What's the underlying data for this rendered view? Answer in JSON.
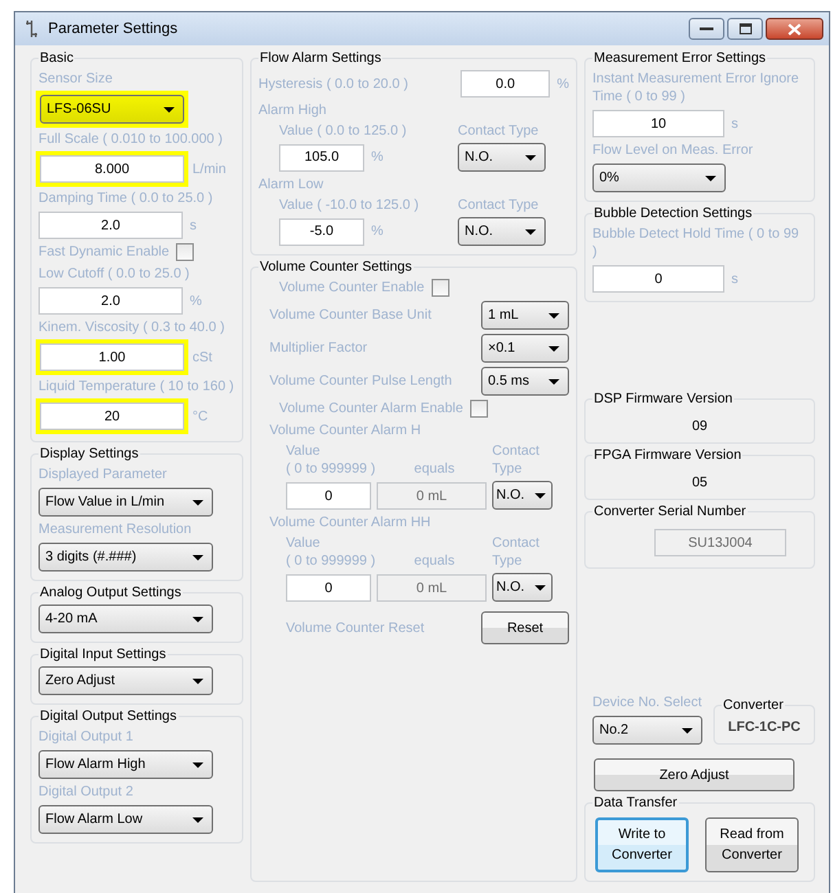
{
  "window": {
    "title": "Parameter Settings"
  },
  "columns": [
    {
      "items": [
        {
          "kind": "group",
          "title": "Basic",
          "items": [
            {
              "kind": "label",
              "text": "Sensor Size"
            },
            {
              "kind": "select",
              "value": "LFS-06SU",
              "highlighted": true
            },
            {
              "kind": "label",
              "text": "Full Scale ( 0.010 to 100.000 )"
            },
            {
              "kind": "field",
              "value": "8.000",
              "unit": "L/min",
              "highlighted": true
            },
            {
              "kind": "label",
              "text": "Damping Time ( 0.0 to 25.0 )"
            },
            {
              "kind": "field",
              "value": "2.0",
              "unit": "s",
              "highlighted": false
            },
            {
              "kind": "checkbox",
              "label": "Fast Dynamic Enable",
              "checked": false
            },
            {
              "kind": "label",
              "text": "Low Cutoff ( 0.0 to 25.0 )"
            },
            {
              "kind": "field",
              "value": "2.0",
              "unit": "%",
              "highlighted": false
            },
            {
              "kind": "label",
              "text": "Kinem. Viscosity ( 0.3 to 40.0 )"
            },
            {
              "kind": "field",
              "value": "1.00",
              "unit": "cSt",
              "highlighted": true
            },
            {
              "kind": "label",
              "text": "Liquid Temperature ( 10 to 160 )"
            },
            {
              "kind": "field",
              "value": "20",
              "unit": "°C",
              "highlighted": true
            }
          ]
        },
        {
          "kind": "group",
          "title": "Display Settings",
          "items": [
            {
              "kind": "label",
              "text": "Displayed Parameter"
            },
            {
              "kind": "select",
              "value": "Flow Value in L/min",
              "highlighted": false
            },
            {
              "kind": "label",
              "text": "Measurement Resolution"
            },
            {
              "kind": "select",
              "value": "3 digits (#.###)",
              "highlighted": false
            }
          ]
        },
        {
          "kind": "group",
          "title": "Analog Output Settings",
          "items": [
            {
              "kind": "select",
              "value": "4-20 mA",
              "highlighted": false
            }
          ]
        },
        {
          "kind": "group",
          "title": "Digital Input Settings",
          "items": [
            {
              "kind": "select",
              "value": "Zero Adjust",
              "highlighted": false
            }
          ]
        },
        {
          "kind": "group",
          "title": "Digital Output Settings",
          "items": [
            {
              "kind": "label",
              "text": "Digital Output 1"
            },
            {
              "kind": "select",
              "value": "Flow Alarm High",
              "highlighted": false
            },
            {
              "kind": "label",
              "text": "Digital Output 2"
            },
            {
              "kind": "select",
              "value": "Flow Alarm Low",
              "highlighted": false
            }
          ]
        }
      ]
    },
    {
      "items": [
        {
          "kind": "group",
          "title": "Flow Alarm Settings",
          "items": [
            {
              "kind": "labeled_field",
              "label": "Hysteresis ( 0.0 to 20.0 )",
              "value": "0.0",
              "unit": "%"
            },
            {
              "kind": "alarm",
              "title": "Alarm High",
              "value_label": "Value ( 0.0 to 125.0 )",
              "value": "105.0",
              "unit": "%",
              "contact_label": "Contact Type",
              "contact": "N.O."
            },
            {
              "kind": "alarm",
              "title": "Alarm Low",
              "value_label": "Value ( -10.0 to 125.0 )",
              "value": "-5.0",
              "unit": "%",
              "contact_label": "Contact Type",
              "contact": "N.O."
            }
          ]
        },
        {
          "kind": "group",
          "title": "Volume Counter Settings",
          "items": [
            {
              "kind": "checkbox",
              "label": "Volume Counter Enable",
              "checked": false
            },
            {
              "kind": "labeled_select",
              "label": "Volume Counter Base Unit",
              "value": "1 mL"
            },
            {
              "kind": "labeled_select",
              "label": "Multiplier Factor",
              "value": "×0.1"
            },
            {
              "kind": "labeled_select",
              "label": "Volume Counter Pulse Length",
              "value": "0.5 ms"
            },
            {
              "kind": "checkbox",
              "label": "Volume Counter Alarm Enable",
              "checked": false
            },
            {
              "kind": "counter_alarm",
              "title": "Volume Counter Alarm H",
              "value_label": "Value\n( 0 to 999999 )",
              "equals_label": "equals",
              "value": "0",
              "equals_value": "0 mL",
              "contact_label": "Contact Type",
              "contact": "N.O."
            },
            {
              "kind": "counter_alarm",
              "title": "Volume Counter Alarm HH",
              "value_label": "Value\n( 0 to 999999 )",
              "equals_label": "equals",
              "value": "0",
              "equals_value": "0 mL",
              "contact_label": "Contact Type",
              "contact": "N.O."
            },
            {
              "kind": "labeled_button",
              "label": "Volume Counter Reset",
              "button": "Reset"
            }
          ]
        }
      ]
    },
    {
      "items": [
        {
          "kind": "group",
          "title": "Measurement Error Settings",
          "items": [
            {
              "kind": "label",
              "text": "Instant Measurement Error Ignore Time ( 0 to 99 )"
            },
            {
              "kind": "field",
              "value": "10",
              "unit": "s",
              "highlighted": false
            },
            {
              "kind": "label",
              "text": "Flow Level on Meas. Error"
            },
            {
              "kind": "select",
              "value": "0%",
              "highlighted": false
            }
          ]
        },
        {
          "kind": "group",
          "title": "Bubble Detection Settings",
          "items": [
            {
              "kind": "label",
              "text": "Bubble Detect Hold Time ( 0 to 99 )"
            },
            {
              "kind": "field",
              "value": "0",
              "unit": "s",
              "highlighted": false
            }
          ]
        },
        {
          "kind": "readout",
          "title": "DSP Firmware Version",
          "value": "09"
        },
        {
          "kind": "readout",
          "title": "FPGA Firmware Version",
          "value": "05"
        },
        {
          "kind": "readonly",
          "title": "Converter Serial Number",
          "value": "SU13J004"
        },
        {
          "kind": "device_row",
          "label": "Device No. Select",
          "value": "No.2",
          "converter_title": "Converter",
          "converter_model": "LFC-1C-PC"
        },
        {
          "kind": "button",
          "label": "Zero Adjust"
        },
        {
          "kind": "transfer",
          "title": "Data Transfer",
          "buttons": [
            {
              "label": "Write to Converter",
              "focused": true
            },
            {
              "label": "Read from Converter",
              "focused": false
            }
          ]
        }
      ]
    }
  ]
}
